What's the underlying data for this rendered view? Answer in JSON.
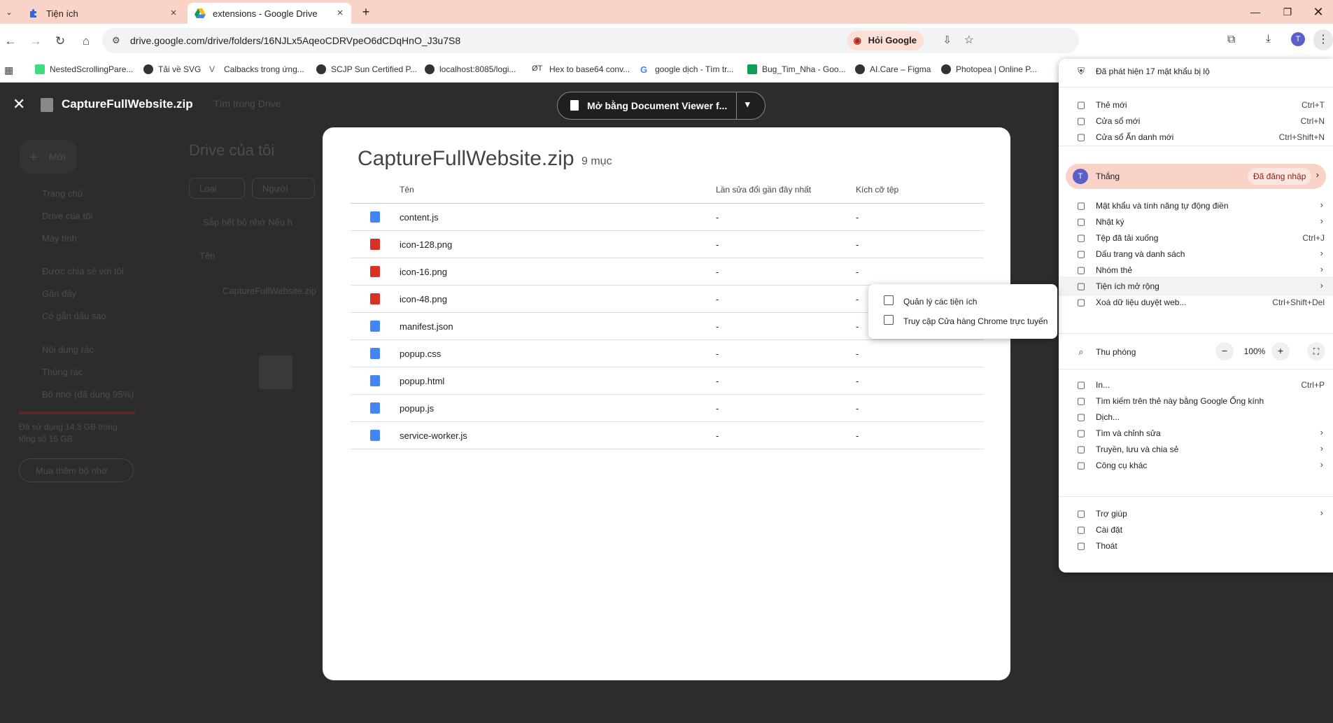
{
  "tabs": [
    {
      "label": "Tiện ích",
      "icon": "puzzle-icon",
      "active": false
    },
    {
      "label": "extensions - Google Drive",
      "icon": "google-drive-icon",
      "active": true
    }
  ],
  "address": {
    "url": "drive.google.com/drive/folders/16NJLx5AqeoCDRVpeO6dCDqHnO_J3u7S8",
    "ask_google": "Hỏi Google"
  },
  "profile_initial": "T",
  "bookmarks": [
    {
      "label": "NestedScrollingPare..."
    },
    {
      "label": "Tải về SVG"
    },
    {
      "label": "Calbacks trong ứng..."
    },
    {
      "label": "SCJP Sun Certified P..."
    },
    {
      "label": "localhost:8085/logi..."
    },
    {
      "label": "Hex to base64 conv..."
    },
    {
      "label": "google dịch - Tìm tr..."
    },
    {
      "label": "Bug_Tim_Nha - Goo..."
    },
    {
      "label": "AI.Care – Figma"
    },
    {
      "label": "Photopea | Online P..."
    }
  ],
  "drive_bg": {
    "search_placeholder": "Tìm trong Drive",
    "new_button": "Mới",
    "breadcrumb": "Drive của tôi",
    "filters": [
      "Loại",
      "Người"
    ],
    "storage_warning": "Sắp hết bộ nhớ Nếu h",
    "sort_label": "Tên",
    "file_row": "CaptureFullWebsite.zip",
    "nav": [
      "Trang chủ",
      "Drive của tôi",
      "Máy tính",
      "Được chia sẻ với tôi",
      "Gần đây",
      "Có gắn dấu sao",
      "Nội dung rác",
      "Thùng rác",
      "Bộ nhớ (đã dùng 95%)"
    ],
    "storage_text": [
      "Đã sử dụng 14,3 GB trong",
      "tổng số 15 GB"
    ],
    "buy_storage": "Mua thêm bộ nhớ"
  },
  "viewer": {
    "title": "CaptureFullWebsite.zip",
    "open_with": "Mở bằng Document Viewer f..."
  },
  "archive": {
    "title": "CaptureFullWebsite.zip",
    "count": "9 mục",
    "headers": [
      "Tên",
      "Lần sửa đổi gần đây nhất",
      "Kích cỡ tệp"
    ],
    "files": [
      {
        "name": "content.js",
        "type": "doc",
        "modified": "-",
        "size": "-"
      },
      {
        "name": "icon-128.png",
        "type": "image",
        "modified": "-",
        "size": "-"
      },
      {
        "name": "icon-16.png",
        "type": "image",
        "modified": "-",
        "size": "-"
      },
      {
        "name": "icon-48.png",
        "type": "image",
        "modified": "-",
        "size": "-"
      },
      {
        "name": "manifest.json",
        "type": "doc",
        "modified": "-",
        "size": "-"
      },
      {
        "name": "popup.css",
        "type": "doc",
        "modified": "-",
        "size": "-"
      },
      {
        "name": "popup.html",
        "type": "doc",
        "modified": "-",
        "size": "-"
      },
      {
        "name": "popup.js",
        "type": "doc",
        "modified": "-",
        "size": "-"
      },
      {
        "name": "service-worker.js",
        "type": "doc",
        "modified": "-",
        "size": "-"
      }
    ]
  },
  "menu": {
    "password_alert": "Đã phát hiện 17 mật khẩu bị lộ",
    "items_top": [
      {
        "label": "Thẻ mới",
        "shortcut": "Ctrl+T",
        "icon": "new-tab-icon"
      },
      {
        "label": "Cửa sổ mới",
        "shortcut": "Ctrl+N",
        "icon": "new-window-icon"
      },
      {
        "label": "Cửa sổ Ẩn danh mới",
        "shortcut": "Ctrl+Shift+N",
        "icon": "incognito-icon"
      }
    ],
    "profile": {
      "name": "Thắng",
      "status": "Đã đăng nhập",
      "initial": "T"
    },
    "items_mid": [
      {
        "label": "Mật khẩu và tính năng tự động điền",
        "shortcut": "",
        "arrow": true,
        "icon": "key-icon"
      },
      {
        "label": "Nhật ký",
        "shortcut": "",
        "arrow": true,
        "icon": "history-icon"
      },
      {
        "label": "Tệp đã tải xuống",
        "shortcut": "Ctrl+J",
        "arrow": false,
        "icon": "download-icon"
      },
      {
        "label": "Dấu trang và danh sách",
        "shortcut": "",
        "arrow": true,
        "icon": "star-icon"
      },
      {
        "label": "Nhóm thẻ",
        "shortcut": "",
        "arrow": true,
        "icon": "tab-groups-icon"
      },
      {
        "label": "Tiện ích mở rộng",
        "shortcut": "",
        "arrow": true,
        "icon": "puzzle-icon"
      },
      {
        "label": "Xoá dữ liệu duyệt web...",
        "shortcut": "Ctrl+Shift+Del",
        "arrow": false,
        "icon": "trash-icon"
      }
    ],
    "zoom": {
      "label": "Thu phóng",
      "value": "100%",
      "minus": "−",
      "plus": "+"
    },
    "items_bottom": [
      {
        "label": "In...",
        "shortcut": "Ctrl+P",
        "arrow": false,
        "icon": "print-icon"
      },
      {
        "label": "Tìm kiếm trên thẻ này bằng Google Ống kính",
        "shortcut": "",
        "arrow": false,
        "icon": "lens-icon"
      },
      {
        "label": "Dịch...",
        "shortcut": "",
        "arrow": false,
        "icon": "translate-icon"
      },
      {
        "label": "Tìm và chỉnh sửa",
        "shortcut": "",
        "arrow": true,
        "icon": "find-icon"
      },
      {
        "label": "Truyền, lưu và chia sẻ",
        "shortcut": "",
        "arrow": true,
        "icon": "cast-icon"
      },
      {
        "label": "Công cụ khác",
        "shortcut": "",
        "arrow": true,
        "icon": "toolbox-icon"
      }
    ],
    "items_footer": [
      {
        "label": "Trợ giúp",
        "shortcut": "",
        "arrow": true,
        "icon": "help-icon"
      },
      {
        "label": "Cài đặt",
        "shortcut": "",
        "arrow": false,
        "icon": "settings-icon"
      },
      {
        "label": "Thoát",
        "shortcut": "",
        "arrow": false,
        "icon": "exit-icon"
      }
    ]
  },
  "submenu": {
    "items": [
      "Quản lý các tiện ích",
      "Truy cập Cửa hàng Chrome trực tuyến"
    ]
  },
  "colors": {
    "doc_icon": "#4285f4",
    "image_icon": "#d93025",
    "tabstrip": "#f9d3c8",
    "accent_profile": "#5b5fc7"
  }
}
